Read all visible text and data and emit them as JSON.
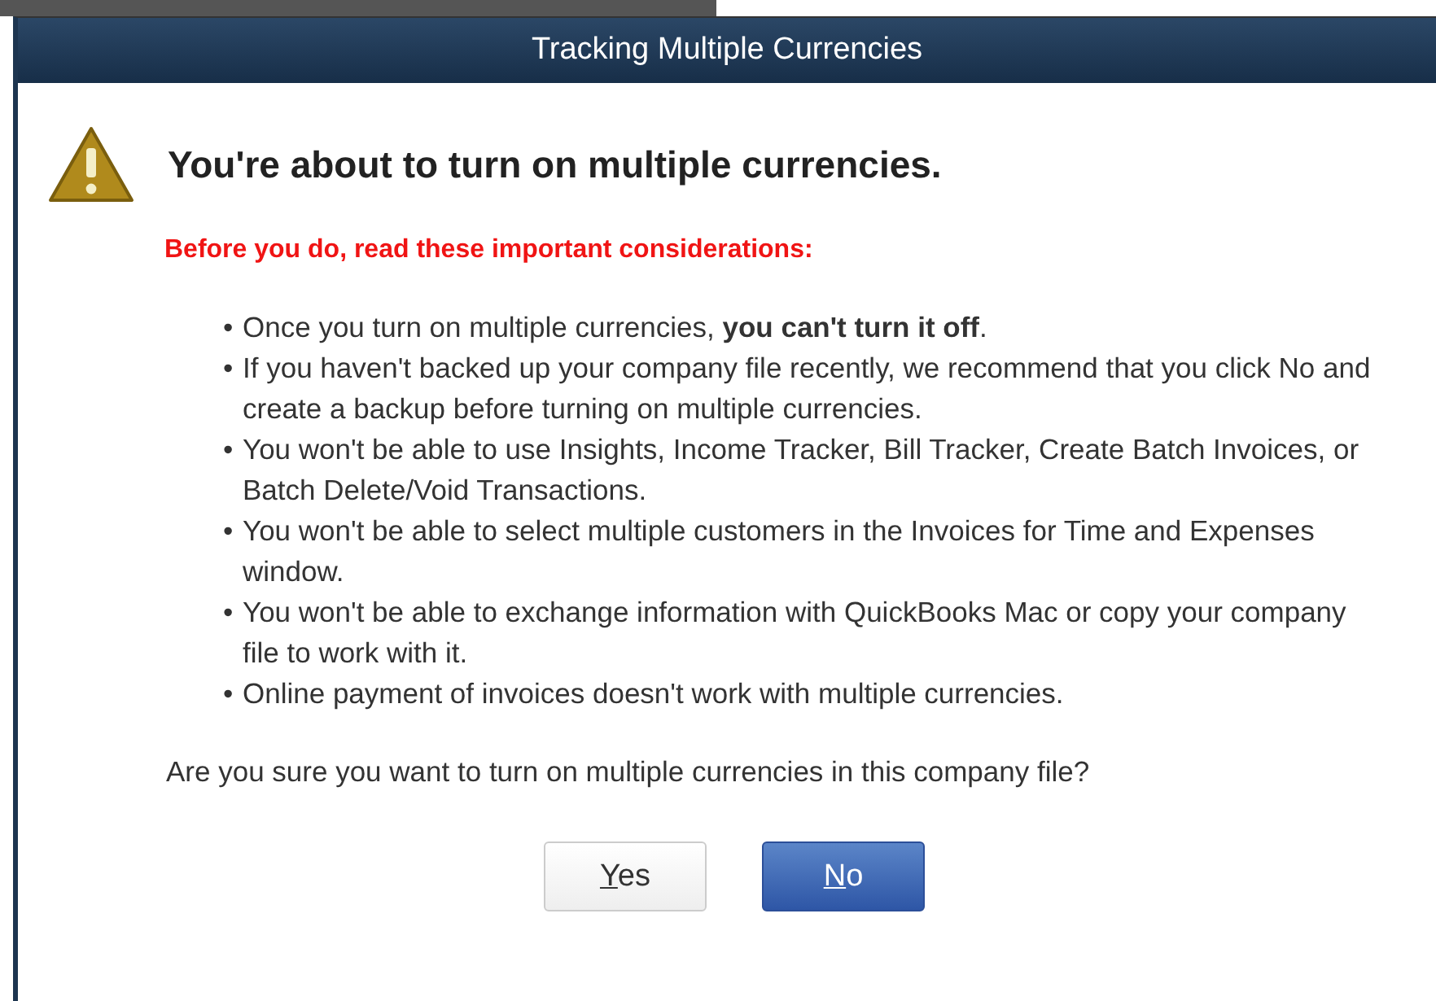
{
  "window": {
    "title": "Tracking Multiple Currencies"
  },
  "heading": "You're about to turn on multiple currencies.",
  "warning": "Before you do, read these important considerations:",
  "considerations": [
    {
      "bullet": "•",
      "text": "Once you turn on multiple currencies, **you can't turn it off**."
    },
    {
      "bullet": "•",
      "text": "If you haven't backed up your company file recently, we recommend that you click No and create a backup before turning on multiple currencies."
    },
    {
      "bullet": "•",
      "text": "You won't be able to use Insights, Income Tracker, Bill Tracker, Create Batch Invoices, or Batch Delete/Void Transactions."
    },
    {
      "bullet": "•",
      "text": "You won't be able to select multiple customers in the Invoices for Time and Expenses window."
    },
    {
      "bullet": "•",
      "text": "You won't be able to exchange information with QuickBooks Mac or copy your company file to work with it."
    },
    {
      "bullet": "•",
      "text": "Online payment of invoices doesn't work with multiple currencies."
    }
  ],
  "question": "Are you sure you want to turn on multiple currencies in this company file?",
  "buttons": [
    {
      "label": "Yes",
      "selected": false
    },
    {
      "label": "No",
      "selected": true
    }
  ]
}
